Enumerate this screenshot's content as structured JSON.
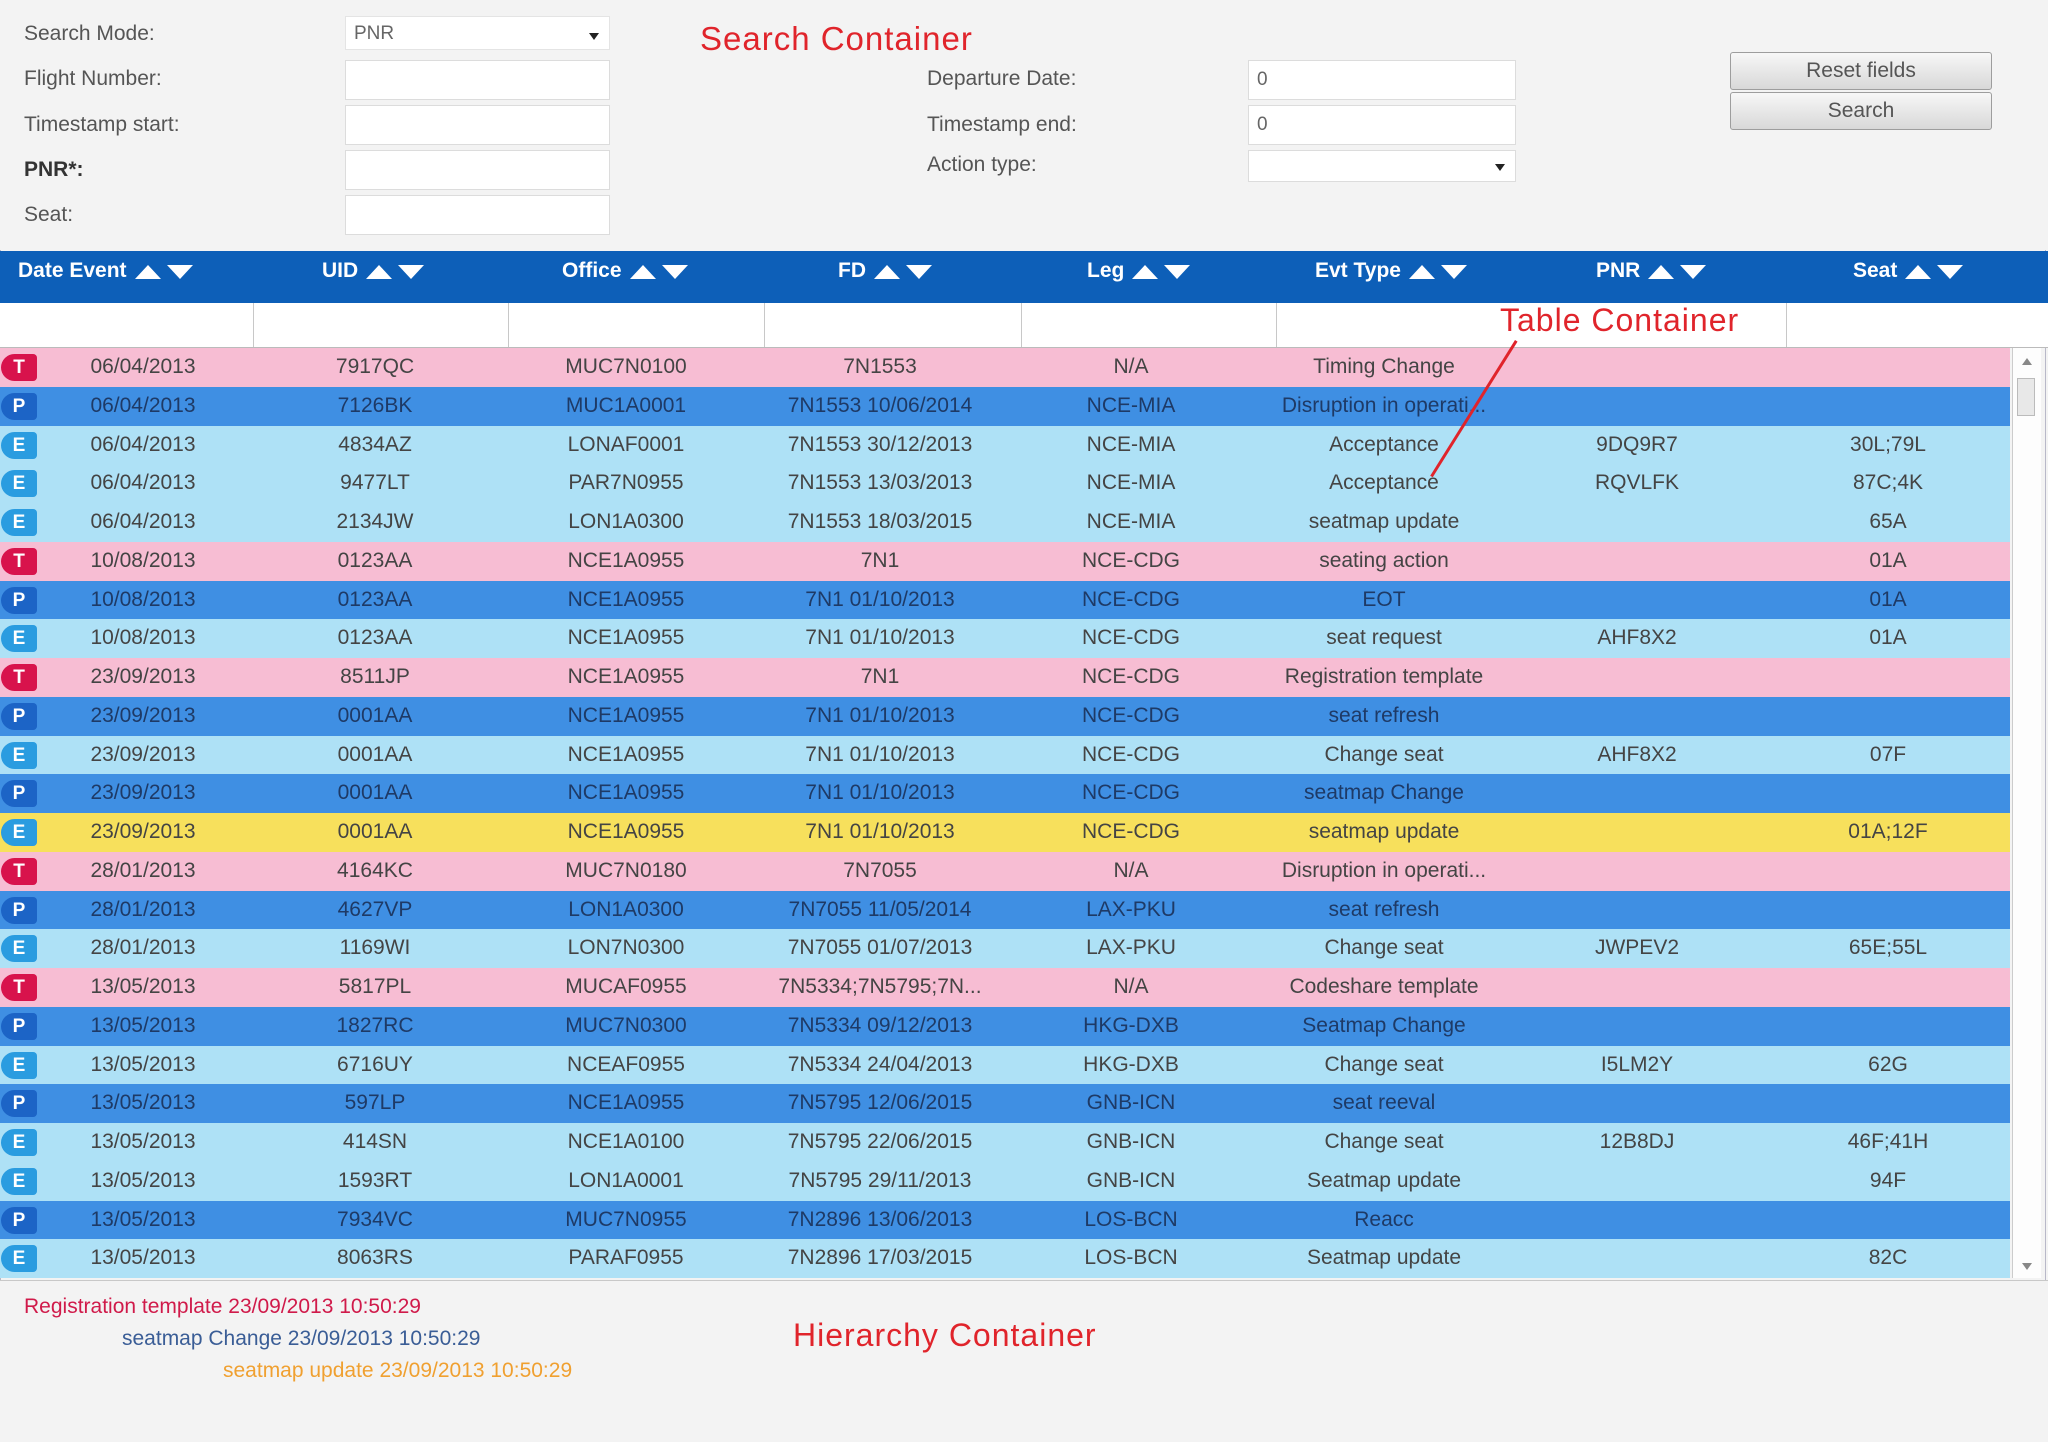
{
  "annotations": {
    "search": "Search Container",
    "table": "Table Container",
    "hierarchy": "Hierarchy Container"
  },
  "search": {
    "search_mode_label": "Search Mode:",
    "search_mode_value": "PNR",
    "flight_number_label": "Flight Number:",
    "timestamp_start_label": "Timestamp start:",
    "pnr_label": "PNR*:",
    "seat_label": "Seat:",
    "departure_date_label": "Departure Date:",
    "departure_date_value": "0",
    "timestamp_end_label": "Timestamp end:",
    "timestamp_end_value": "0",
    "action_type_label": "Action type:",
    "reset_label": "Reset fields",
    "search_label": "Search"
  },
  "table": {
    "headers": [
      "Date Event",
      "UID",
      "Office",
      "FD",
      "Leg",
      "Evt Type",
      "PNR",
      "Seat"
    ],
    "rows": [
      {
        "type": "T",
        "badge": "T",
        "date": "06/04/2013",
        "uid": "7917QC",
        "office": "MUC7N0100",
        "fd": "7N1553",
        "leg": "N/A",
        "evt": "Timing Change",
        "pnr": "",
        "seat": ""
      },
      {
        "type": "P",
        "badge": "P",
        "date": "06/04/2013",
        "uid": "7126BK",
        "office": "MUC1A0001",
        "fd": "7N1553 10/06/2014",
        "leg": "NCE-MIA",
        "evt": "Disruption in operati...",
        "pnr": "",
        "seat": ""
      },
      {
        "type": "E",
        "badge": "E",
        "date": "06/04/2013",
        "uid": "4834AZ",
        "office": "LONAF0001",
        "fd": "7N1553 30/12/2013",
        "leg": "NCE-MIA",
        "evt": "Acceptance",
        "pnr": "9DQ9R7",
        "seat": "30L;79L"
      },
      {
        "type": "E",
        "badge": "E",
        "date": "06/04/2013",
        "uid": "9477LT",
        "office": "PAR7N0955",
        "fd": "7N1553 13/03/2013",
        "leg": "NCE-MIA",
        "evt": "Acceptance",
        "pnr": "RQVLFK",
        "seat": "87C;4K"
      },
      {
        "type": "E",
        "badge": "E",
        "date": "06/04/2013",
        "uid": "2134JW",
        "office": "LON1A0300",
        "fd": "7N1553 18/03/2015",
        "leg": "NCE-MIA",
        "evt": "seatmap update",
        "pnr": "",
        "seat": "65A"
      },
      {
        "type": "T",
        "badge": "T",
        "date": "10/08/2013",
        "uid": "0123AA",
        "office": "NCE1A0955",
        "fd": "7N1",
        "leg": "NCE-CDG",
        "evt": "seating action",
        "pnr": "",
        "seat": "01A"
      },
      {
        "type": "P",
        "badge": "P",
        "date": "10/08/2013",
        "uid": "0123AA",
        "office": "NCE1A0955",
        "fd": "7N1 01/10/2013",
        "leg": "NCE-CDG",
        "evt": "EOT",
        "pnr": "",
        "seat": "01A"
      },
      {
        "type": "E",
        "badge": "E",
        "date": "10/08/2013",
        "uid": "0123AA",
        "office": "NCE1A0955",
        "fd": "7N1 01/10/2013",
        "leg": "NCE-CDG",
        "evt": "seat request",
        "pnr": "AHF8X2",
        "seat": "01A"
      },
      {
        "type": "T",
        "badge": "T",
        "date": "23/09/2013",
        "uid": "8511JP",
        "office": "NCE1A0955",
        "fd": "7N1",
        "leg": "NCE-CDG",
        "evt": "Registration template",
        "pnr": "",
        "seat": ""
      },
      {
        "type": "P",
        "badge": "P",
        "date": "23/09/2013",
        "uid": "0001AA",
        "office": "NCE1A0955",
        "fd": "7N1 01/10/2013",
        "leg": "NCE-CDG",
        "evt": "seat refresh",
        "pnr": "",
        "seat": ""
      },
      {
        "type": "E",
        "badge": "E",
        "date": "23/09/2013",
        "uid": "0001AA",
        "office": "NCE1A0955",
        "fd": "7N1 01/10/2013",
        "leg": "NCE-CDG",
        "evt": "Change seat",
        "pnr": "AHF8X2",
        "seat": "07F"
      },
      {
        "type": "P",
        "badge": "P",
        "date": "23/09/2013",
        "uid": "0001AA",
        "office": "NCE1A0955",
        "fd": "7N1 01/10/2013",
        "leg": "NCE-CDG",
        "evt": "seatmap Change",
        "pnr": "",
        "seat": ""
      },
      {
        "type": "Y",
        "badge": "E",
        "date": "23/09/2013",
        "uid": "0001AA",
        "office": "NCE1A0955",
        "fd": "7N1 01/10/2013",
        "leg": "NCE-CDG",
        "evt": "seatmap update",
        "pnr": "",
        "seat": "01A;12F"
      },
      {
        "type": "T",
        "badge": "T",
        "date": "28/01/2013",
        "uid": "4164KC",
        "office": "MUC7N0180",
        "fd": "7N7055",
        "leg": "N/A",
        "evt": "Disruption in operati...",
        "pnr": "",
        "seat": ""
      },
      {
        "type": "P",
        "badge": "P",
        "date": "28/01/2013",
        "uid": "4627VP",
        "office": "LON1A0300",
        "fd": "7N7055 11/05/2014",
        "leg": "LAX-PKU",
        "evt": "seat refresh",
        "pnr": "",
        "seat": ""
      },
      {
        "type": "E",
        "badge": "E",
        "date": "28/01/2013",
        "uid": "1169WI",
        "office": "LON7N0300",
        "fd": "7N7055 01/07/2013",
        "leg": "LAX-PKU",
        "evt": "Change seat",
        "pnr": "JWPEV2",
        "seat": "65E;55L"
      },
      {
        "type": "T",
        "badge": "T",
        "date": "13/05/2013",
        "uid": "5817PL",
        "office": "MUCAF0955",
        "fd": "7N5334;7N5795;7N...",
        "leg": "N/A",
        "evt": "Codeshare template",
        "pnr": "",
        "seat": ""
      },
      {
        "type": "P",
        "badge": "P",
        "date": "13/05/2013",
        "uid": "1827RC",
        "office": "MUC7N0300",
        "fd": "7N5334 09/12/2013",
        "leg": "HKG-DXB",
        "evt": "Seatmap Change",
        "pnr": "",
        "seat": ""
      },
      {
        "type": "E",
        "badge": "E",
        "date": "13/05/2013",
        "uid": "6716UY",
        "office": "NCEAF0955",
        "fd": "7N5334 24/04/2013",
        "leg": "HKG-DXB",
        "evt": "Change seat",
        "pnr": "I5LM2Y",
        "seat": "62G"
      },
      {
        "type": "P",
        "badge": "P",
        "date": "13/05/2013",
        "uid": "597LP",
        "office": "NCE1A0955",
        "fd": "7N5795 12/06/2015",
        "leg": "GNB-ICN",
        "evt": "seat reeval",
        "pnr": "",
        "seat": ""
      },
      {
        "type": "E",
        "badge": "E",
        "date": "13/05/2013",
        "uid": "414SN",
        "office": "NCE1A0100",
        "fd": "7N5795 22/06/2015",
        "leg": "GNB-ICN",
        "evt": "Change seat",
        "pnr": "12B8DJ",
        "seat": "46F;41H"
      },
      {
        "type": "E",
        "badge": "E",
        "date": "13/05/2013",
        "uid": "1593RT",
        "office": "LON1A0001",
        "fd": "7N5795 29/11/2013",
        "leg": "GNB-ICN",
        "evt": "Seatmap update",
        "pnr": "",
        "seat": "94F"
      },
      {
        "type": "P",
        "badge": "P",
        "date": "13/05/2013",
        "uid": "7934VC",
        "office": "MUC7N0955",
        "fd": "7N2896 13/06/2013",
        "leg": "LOS-BCN",
        "evt": "Reacc",
        "pnr": "",
        "seat": ""
      },
      {
        "type": "E",
        "badge": "E",
        "date": "13/05/2013",
        "uid": "8063RS",
        "office": "PARAF0955",
        "fd": "7N2896 17/03/2015",
        "leg": "LOS-BCN",
        "evt": "Seatmap update",
        "pnr": "",
        "seat": "82C"
      }
    ]
  },
  "hierarchy": [
    {
      "text": "Registration template 23/09/2013 10:50:29",
      "color": "#d01a4a",
      "indent": 0
    },
    {
      "text": "seatmap Change 23/09/2013 10:50:29",
      "color": "#3a5d96",
      "indent": 1
    },
    {
      "text": "seatmap update 23/09/2013 10:50:29",
      "color": "#f0a030",
      "indent": 2
    }
  ]
}
